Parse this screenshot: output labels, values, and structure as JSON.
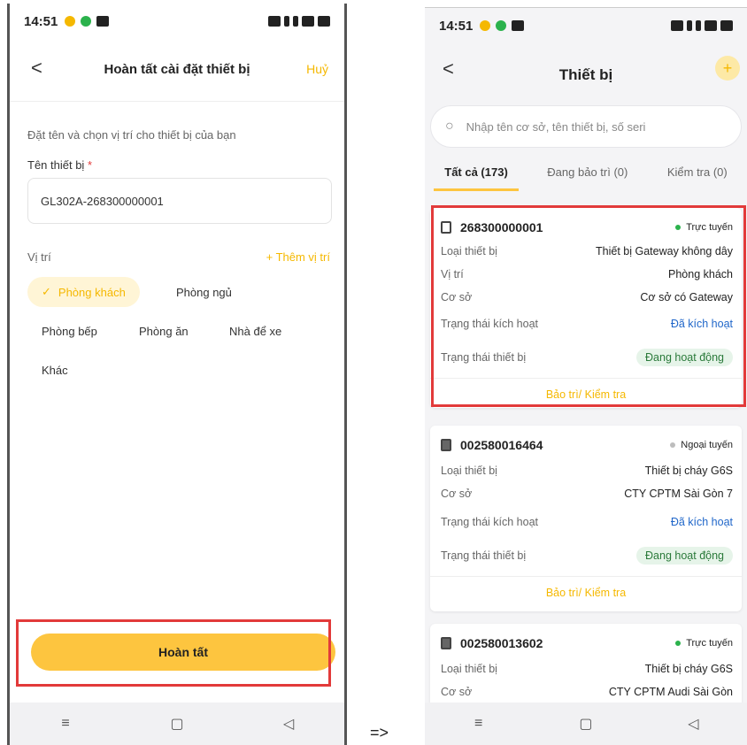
{
  "left": {
    "statusbar": {
      "time": "14:51"
    },
    "header": {
      "back": "<",
      "title": "Hoàn tất cài đặt thiết bị",
      "cancel": "Huỷ"
    },
    "hint": "Đặt tên và chọn vị trí cho thiết bị của bạn",
    "field_label": "Tên thiết bị",
    "required_mark": "*",
    "device_name": "GL302A-268300000001",
    "location_label": "Vị trí",
    "add_location": "+ Thêm vị trí",
    "chips": [
      "Phòng khách",
      "Phòng ngủ",
      "Phòng bếp",
      "Phòng ăn",
      "Nhà để xe",
      "Khác"
    ],
    "selected_chip": "Phòng khách",
    "done_label": "Hoàn tất"
  },
  "arrow": "=>",
  "right": {
    "statusbar": {
      "time": "14:51"
    },
    "header": {
      "back": "<",
      "title": "Thiết bị",
      "add": "+"
    },
    "search_placeholder": "Nhập tên cơ sở, tên thiết bị, số seri",
    "tabs": [
      "Tất cả (173)",
      "Đang bảo trì (0)",
      "Kiểm tra (0)"
    ],
    "cards": [
      {
        "serial": "268300000001",
        "status": "Trực tuyến",
        "rows": [
          {
            "k": "Loại thiết bị",
            "v": "Thiết bị Gateway không dây"
          },
          {
            "k": "Vị trí",
            "v": "Phòng khách"
          },
          {
            "k": "Cơ sở",
            "v": "Cơ sở có Gateway"
          },
          {
            "k": "Trạng thái kích hoạt",
            "v": "Đã kích hoạt"
          },
          {
            "k": "Trạng thái thiết bị",
            "v": "Đang hoạt động"
          }
        ],
        "action": "Bảo trì/ Kiểm tra"
      },
      {
        "serial": "002580016464",
        "status": "Ngoại tuyến",
        "rows": [
          {
            "k": "Loại thiết bị",
            "v": "Thiết bị cháy G6S"
          },
          {
            "k": "Cơ sở",
            "v": "CTY CPTM Sài Gòn 7"
          },
          {
            "k": "Trạng thái kích hoạt",
            "v": "Đã kích hoạt"
          },
          {
            "k": "Trạng thái thiết bị",
            "v": "Đang hoạt động"
          }
        ],
        "action": "Bảo trì/ Kiểm tra"
      },
      {
        "serial": "002580013602",
        "status": "Trực tuyến",
        "rows": [
          {
            "k": "Loại thiết bị",
            "v": "Thiết bị cháy G6S"
          },
          {
            "k": "Cơ sở",
            "v": "CTY CPTM Audi Sài Gòn"
          }
        ]
      }
    ]
  },
  "nav": {
    "menu": "≡",
    "home": "▢",
    "back": "◁"
  },
  "colors": {
    "accent": "#fdc53f",
    "accent_text": "#f5b800",
    "highlight": "#e23a3a",
    "online": "#2bb24c",
    "offline": "#bdbdbd",
    "link": "#1f66c9"
  }
}
